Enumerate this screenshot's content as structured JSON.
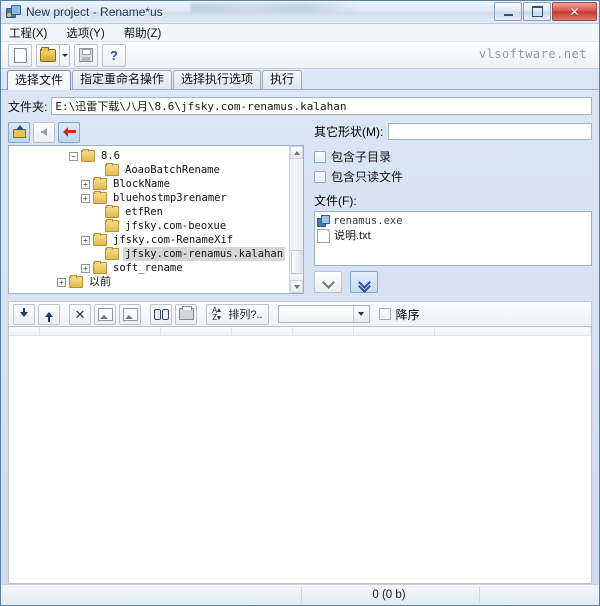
{
  "window": {
    "title": "New project - Rename*us",
    "app_icon": "app-icon",
    "controls": {
      "minimize": "—",
      "maximize": "□",
      "close": "✕"
    }
  },
  "menu": [
    {
      "label": "工程(X)"
    },
    {
      "label": "选项(Y)"
    },
    {
      "label": "帮助(Z)"
    }
  ],
  "toolbar": {
    "new_label": "新建",
    "open_label": "打开",
    "save_label": "保存",
    "help_label": "帮助",
    "watermark": "vlsoftware.net"
  },
  "tabs": [
    {
      "label": "选择文件",
      "active": true
    },
    {
      "label": "指定重命名操作",
      "active": false
    },
    {
      "label": "选择执行选项",
      "active": false
    },
    {
      "label": "执行",
      "active": false
    }
  ],
  "folder": {
    "label": "文件夹:",
    "value": "E:\\迅雷下载\\八月\\8.6\\jfsky.com-renamus.kalahan",
    "placeholder": ""
  },
  "nav_buttons": [
    {
      "name": "up-folder",
      "label": "上级目录"
    },
    {
      "name": "back",
      "label": "后退"
    },
    {
      "name": "refresh",
      "label": "刷新"
    }
  ],
  "tree": {
    "items": [
      {
        "label": "8.6",
        "expander": "−",
        "indent": 5,
        "selected": false,
        "cjk": false
      },
      {
        "label": "AoaoBatchRename",
        "expander": "",
        "indent": 7,
        "selected": false,
        "cjk": false
      },
      {
        "label": "BlockName",
        "expander": "+",
        "indent": 6,
        "selected": false,
        "cjk": false
      },
      {
        "label": "bluehostmp3renamer",
        "expander": "+",
        "indent": 6,
        "selected": false,
        "cjk": false
      },
      {
        "label": "etfRen",
        "expander": "",
        "indent": 7,
        "selected": false,
        "cjk": false
      },
      {
        "label": "jfsky.com-beoxue",
        "expander": "",
        "indent": 7,
        "selected": false,
        "cjk": false
      },
      {
        "label": "jfsky.com-RenameXif",
        "expander": "+",
        "indent": 6,
        "selected": false,
        "cjk": false
      },
      {
        "label": "jfsky.com-renamus.kalahan",
        "expander": "",
        "indent": 7,
        "selected": true,
        "cjk": false
      },
      {
        "label": "soft_rename",
        "expander": "+",
        "indent": 6,
        "selected": false,
        "cjk": false
      },
      {
        "label": "以前",
        "expander": "+",
        "indent": 3,
        "selected": false,
        "cjk": true
      }
    ]
  },
  "options": {
    "mask_label": "其它形状(M):",
    "mask_value": "",
    "include_subdirs": {
      "label": "包含子目录",
      "checked": false
    },
    "include_readonly": {
      "label": "包含只读文件",
      "checked": false
    },
    "files_label": "文件(F):"
  },
  "files": [
    {
      "name": "renamus.exe",
      "icon": "exe-icon",
      "cjk": false
    },
    {
      "name": "说明.txt",
      "icon": "text-file-icon",
      "cjk": true
    }
  ],
  "move_buttons": [
    {
      "name": "add-selected",
      "label": "添加选中"
    },
    {
      "name": "add-all",
      "label": "添加全部"
    }
  ],
  "lower_toolbar": {
    "buttons": [
      {
        "name": "move-down",
        "label": "下移"
      },
      {
        "name": "move-up",
        "label": "上移"
      },
      {
        "name": "remove",
        "label": "移除"
      },
      {
        "name": "preview-image",
        "label": "预览"
      },
      {
        "name": "edit-image",
        "label": "编辑"
      },
      {
        "name": "find",
        "label": "查找"
      },
      {
        "name": "print",
        "label": "打印"
      }
    ],
    "sort_button_label": "排列?..",
    "sort_combo_value": "",
    "descending": {
      "label": "降序",
      "checked": false
    }
  },
  "status": {
    "count_text": "0  (0 b)"
  }
}
